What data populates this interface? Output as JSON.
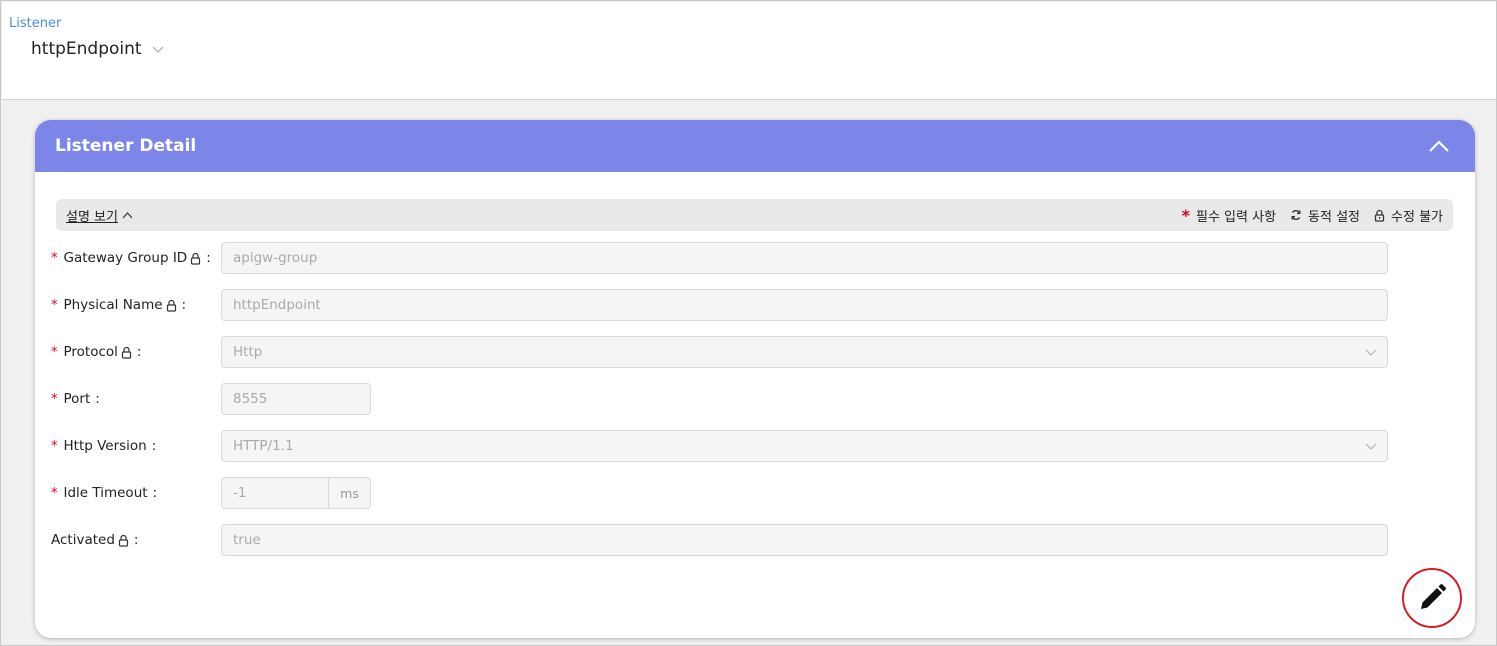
{
  "header": {
    "breadcrumb": "Listener",
    "entity_name": "httpEndpoint"
  },
  "card": {
    "title": "Listener Detail"
  },
  "desc_bar": {
    "toggle_label": "설명 보기",
    "legend_required": "필수 입력 사항",
    "legend_dynamic": "동적 설정",
    "legend_locked": "수정 불가"
  },
  "form": {
    "fields": [
      {
        "label": "Gateway Group ID",
        "required": true,
        "locked": true,
        "value": "apigw-group"
      },
      {
        "label": "Physical Name",
        "required": true,
        "locked": true,
        "value": "httpEndpoint"
      },
      {
        "label": "Protocol",
        "required": true,
        "locked": true,
        "value": "Http",
        "type": "select"
      },
      {
        "label": "Port",
        "required": true,
        "locked": false,
        "value": "8555"
      },
      {
        "label": "Http Version",
        "required": true,
        "locked": false,
        "value": "HTTP/1.1",
        "type": "select"
      },
      {
        "label": "Idle Timeout",
        "required": true,
        "locked": false,
        "value": "-1",
        "unit": "ms"
      },
      {
        "label": "Activated",
        "required": false,
        "locked": true,
        "value": "true"
      }
    ]
  },
  "icons": {
    "entity_dropdown": "chevron-down-icon",
    "collapse": "chevron-up-icon",
    "desc_toggle": "chevron-up-icon",
    "dynamic": "refresh-icon",
    "locked": "lock-icon",
    "edit": "pencil-icon"
  },
  "colors": {
    "card_header": "#7b86e8",
    "required": "#e0001a",
    "edit_ring": "#d41f2a",
    "breadcrumb": "#4a8fd0"
  }
}
